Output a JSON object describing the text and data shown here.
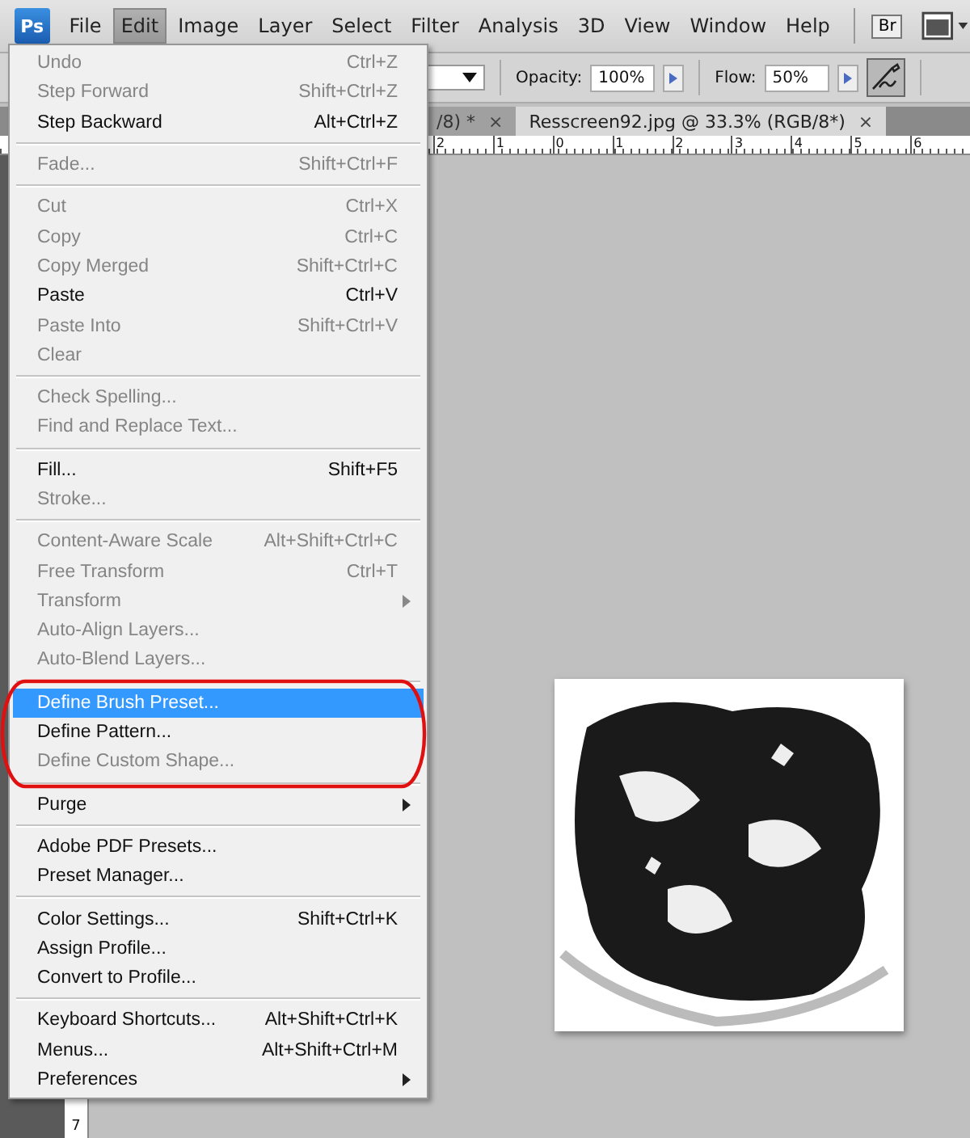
{
  "menubar": {
    "logo": "Ps",
    "items": [
      {
        "label": "File",
        "selected": false
      },
      {
        "label": "Edit",
        "selected": true
      },
      {
        "label": "Image",
        "selected": false
      },
      {
        "label": "Layer",
        "selected": false
      },
      {
        "label": "Select",
        "selected": false
      },
      {
        "label": "Filter",
        "selected": false
      },
      {
        "label": "Analysis",
        "selected": false
      },
      {
        "label": "3D",
        "selected": false
      },
      {
        "label": "View",
        "selected": false
      },
      {
        "label": "Window",
        "selected": false
      },
      {
        "label": "Help",
        "selected": false
      }
    ],
    "bridge_button": "Br"
  },
  "options_bar": {
    "opacity_label": "Opacity:",
    "opacity": "100%",
    "flow_label": "Flow:",
    "flow": "50%",
    "airbrush_on": true
  },
  "tabs": [
    {
      "label": "/8) *",
      "close": "×",
      "selected": false
    },
    {
      "label": "Resscreen92.jpg @ 33.3% (RGB/8*)",
      "close": "×",
      "selected": true
    }
  ],
  "ruler": {
    "top_labels": [
      "2",
      "1",
      "0",
      "1",
      "2",
      "3",
      "4",
      "5",
      "6"
    ],
    "left_labels": [
      "7"
    ]
  },
  "edit_menu": {
    "groups": [
      {
        "items": [
          {
            "label": "Undo",
            "shortcut": "Ctrl+Z",
            "disabled": true,
            "selected": false,
            "submenu": false
          },
          {
            "label": "Step Forward",
            "shortcut": "Shift+Ctrl+Z",
            "disabled": true,
            "selected": false,
            "submenu": false
          },
          {
            "label": "Step Backward",
            "shortcut": "Alt+Ctrl+Z",
            "disabled": false,
            "selected": false,
            "submenu": false
          }
        ]
      },
      {
        "items": [
          {
            "label": "Fade...",
            "shortcut": "Shift+Ctrl+F",
            "disabled": true,
            "selected": false,
            "submenu": false
          }
        ]
      },
      {
        "items": [
          {
            "label": "Cut",
            "shortcut": "Ctrl+X",
            "disabled": true,
            "selected": false,
            "submenu": false
          },
          {
            "label": "Copy",
            "shortcut": "Ctrl+C",
            "disabled": true,
            "selected": false,
            "submenu": false
          },
          {
            "label": "Copy Merged",
            "shortcut": "Shift+Ctrl+C",
            "disabled": true,
            "selected": false,
            "submenu": false
          },
          {
            "label": "Paste",
            "shortcut": "Ctrl+V",
            "disabled": false,
            "selected": false,
            "submenu": false
          },
          {
            "label": "Paste Into",
            "shortcut": "Shift+Ctrl+V",
            "disabled": true,
            "selected": false,
            "submenu": false
          },
          {
            "label": "Clear",
            "disabled": true,
            "selected": false,
            "submenu": false
          }
        ]
      },
      {
        "items": [
          {
            "label": "Check Spelling...",
            "disabled": true,
            "selected": false,
            "submenu": false
          },
          {
            "label": "Find and Replace Text...",
            "disabled": true,
            "selected": false,
            "submenu": false
          }
        ]
      },
      {
        "items": [
          {
            "label": "Fill...",
            "shortcut": "Shift+F5",
            "disabled": false,
            "selected": false,
            "submenu": false
          },
          {
            "label": "Stroke...",
            "disabled": true,
            "selected": false,
            "submenu": false
          }
        ]
      },
      {
        "items": [
          {
            "label": "Content-Aware Scale",
            "shortcut": "Alt+Shift+Ctrl+C",
            "disabled": true,
            "selected": false,
            "submenu": false
          },
          {
            "label": "Free Transform",
            "shortcut": "Ctrl+T",
            "disabled": true,
            "selected": false,
            "submenu": false
          },
          {
            "label": "Transform",
            "disabled": true,
            "selected": false,
            "submenu": true
          },
          {
            "label": "Auto-Align Layers...",
            "disabled": true,
            "selected": false,
            "submenu": false
          },
          {
            "label": "Auto-Blend Layers...",
            "disabled": true,
            "selected": false,
            "submenu": false
          }
        ]
      },
      {
        "items": [
          {
            "label": "Define Brush Preset...",
            "disabled": false,
            "selected": true,
            "submenu": false
          },
          {
            "label": "Define Pattern...",
            "disabled": false,
            "selected": false,
            "submenu": false
          },
          {
            "label": "Define Custom Shape...",
            "disabled": true,
            "selected": false,
            "submenu": false
          }
        ]
      },
      {
        "items": [
          {
            "label": "Purge",
            "disabled": false,
            "selected": false,
            "submenu": true
          }
        ]
      },
      {
        "items": [
          {
            "label": "Adobe PDF Presets...",
            "disabled": false,
            "selected": false,
            "submenu": false
          },
          {
            "label": "Preset Manager...",
            "disabled": false,
            "selected": false,
            "submenu": false
          }
        ]
      },
      {
        "items": [
          {
            "label": "Color Settings...",
            "shortcut": "Shift+Ctrl+K",
            "disabled": false,
            "selected": false,
            "submenu": false
          },
          {
            "label": "Assign Profile...",
            "disabled": false,
            "selected": false,
            "submenu": false
          },
          {
            "label": "Convert to Profile...",
            "disabled": false,
            "selected": false,
            "submenu": false
          }
        ]
      },
      {
        "items": [
          {
            "label": "Keyboard Shortcuts...",
            "shortcut": "Alt+Shift+Ctrl+K",
            "disabled": false,
            "selected": false,
            "submenu": false
          },
          {
            "label": "Menus...",
            "shortcut": "Alt+Shift+Ctrl+M",
            "disabled": false,
            "selected": false,
            "submenu": false
          },
          {
            "label": "Preferences",
            "disabled": false,
            "selected": false,
            "submenu": true
          }
        ]
      }
    ]
  }
}
